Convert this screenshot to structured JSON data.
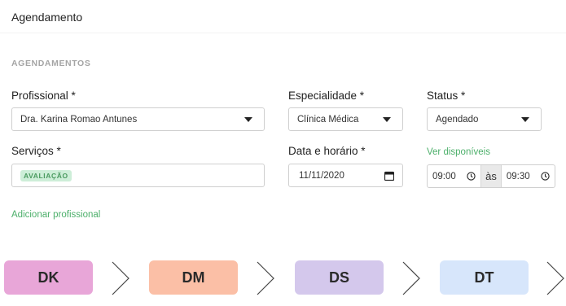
{
  "page": {
    "title": "Agendamento"
  },
  "section": {
    "label": "AGENDAMENTOS"
  },
  "form": {
    "profissional": {
      "label": "Profissional *",
      "value": "Dra. Karina Romao Antunes"
    },
    "especialidade": {
      "label": "Especialidade *",
      "value": "Clínica Médica"
    },
    "status": {
      "label": "Status *",
      "value": "Agendado"
    },
    "servicos": {
      "label": "Serviços *",
      "tags": [
        "AVALIAÇÃO"
      ]
    },
    "data_horario": {
      "label": "Data e horário *",
      "date": "11/11/2020"
    },
    "horario": {
      "link": "Ver disponíveis",
      "start": "09:00",
      "separator": "às",
      "end": "09:30"
    },
    "adicionar_profissional": "Adicionar profissional"
  },
  "steps": [
    {
      "label": "DK",
      "color": "#e8a6d8"
    },
    {
      "label": "DM",
      "color": "#fbbfa6"
    },
    {
      "label": "DS",
      "color": "#d4c8ec"
    },
    {
      "label": "DT",
      "color": "#d7e6fb"
    }
  ],
  "colors": {
    "link": "#4caf6a",
    "tag_bg": "#cdeed8",
    "tag_text": "#4a9a5f"
  }
}
